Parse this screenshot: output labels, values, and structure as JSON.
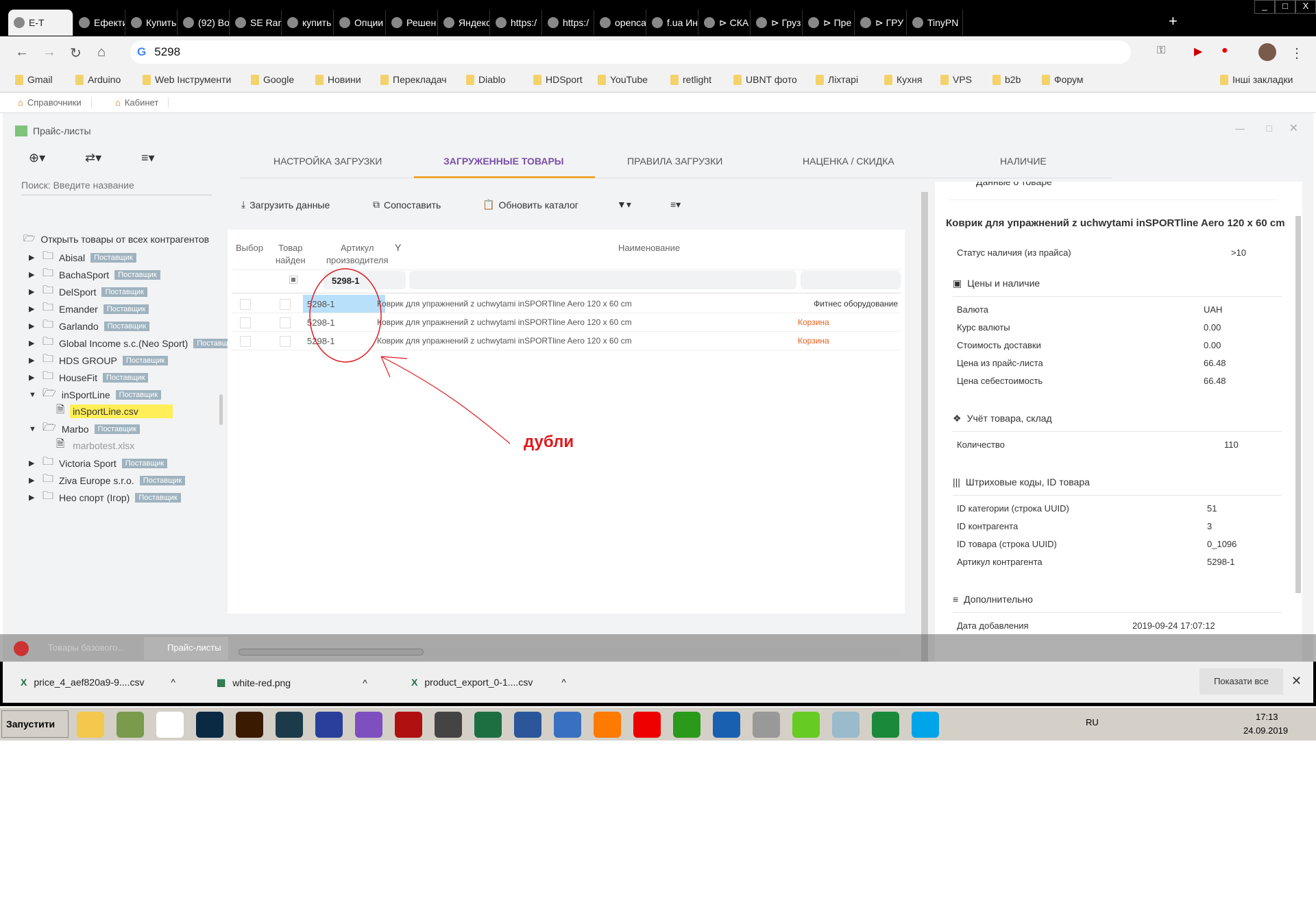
{
  "browser": {
    "tabs": [
      "E-T",
      "Ефекти",
      "Купить",
      "(92) Bo",
      "SE Ran",
      "купить",
      "Опции",
      "Решен",
      "Яндекс",
      "https:/",
      "https:/",
      "openca",
      "f.ua Ин",
      "⊳ СКА",
      "⊳ Груз",
      "⊳ Пре",
      "⊳ ГРУ",
      "TinyPN"
    ],
    "address": "5298",
    "bookmarks": [
      "Gmail",
      "Arduino",
      "Web Інструменти",
      "Google",
      "Новини",
      "Перекладач",
      "Diablo",
      "HDSport",
      "YouTube",
      "retlight",
      "UBNT фото",
      "Ліхтарі",
      "Кухня",
      "VPS",
      "b2b",
      "Форум"
    ],
    "other_bookmarks": "Інші закладки",
    "app_tabs": [
      "Справочники",
      "Кабинет"
    ]
  },
  "window": {
    "title": "Прайс-листы"
  },
  "left": {
    "search_placeholder": "Поиск: Введите название",
    "root": "Открыть товары от всех контрагентов",
    "badge": "Поставщик",
    "items": [
      {
        "name": "Abisal",
        "open": false
      },
      {
        "name": "BachaSport",
        "open": false
      },
      {
        "name": "DelSport",
        "open": false
      },
      {
        "name": "Emander",
        "open": false
      },
      {
        "name": "Garlando",
        "open": false
      },
      {
        "name": "Global Income s.c.(Neo Sport)",
        "open": false
      },
      {
        "name": "HDS GROUP",
        "open": false
      },
      {
        "name": "HouseFit",
        "open": false
      },
      {
        "name": "inSportLine",
        "open": true,
        "file": "inSportLine.csv"
      },
      {
        "name": "Marbo",
        "open": true,
        "file": "marbotest.xlsx"
      },
      {
        "name": "Victoria Sport",
        "open": false
      },
      {
        "name": "Ziva Europe s.r.o.",
        "open": false
      },
      {
        "name": "Нео спорт (Ігор)",
        "open": false
      }
    ]
  },
  "tabs": [
    "Настройка загрузки",
    "Загруженные товары",
    "Правила загрузки",
    "Наценка / скидка",
    "Наличие"
  ],
  "active_tab": 1,
  "toolbar": {
    "load": "Загрузить данные",
    "compare": "Сопоставить",
    "update": "Обновить каталог"
  },
  "table": {
    "headers": {
      "select": "Выбор",
      "found1": "Товар",
      "found2": "найден",
      "art1": "Артикул",
      "art2": "производителя",
      "name": "Наименование"
    },
    "filter_article": "5298-1",
    "rows": [
      {
        "article": "5298-1",
        "name": "Коврик для упражнений z uchwytami inSPORTline Aero 120 x 60 cm",
        "category": "Фитнес оборудование",
        "selected": true
      },
      {
        "article": "5298-1",
        "name": "Коврик для упражнений z uchwytami inSPORTline Aero 120 x 60 cm",
        "category": "Корзина",
        "selected": false
      },
      {
        "article": "5298-1",
        "name": "Коврик для упражнений z uchwytami inSPORTline Aero 120 x 60 cm",
        "category": "Корзина",
        "selected": false
      }
    ]
  },
  "annotation": {
    "text": "дубли",
    "color": "#e0191e"
  },
  "details": {
    "header": "Данные о товаре",
    "title": "Коврик для упражнений z uchwytami inSPORTline Aero 120 x 60 cm",
    "status_label": "Статус наличия (из прайса)",
    "status_value": ">10",
    "prices_title": "Цены и наличие",
    "prices": [
      [
        "Валюта",
        "UAH"
      ],
      [
        "Курс валюты",
        "0.00"
      ],
      [
        "Стоимость доставки",
        "0.00"
      ],
      [
        "Цена из прайс-листа",
        "66.48"
      ],
      [
        "Цена себестоимость",
        "66.48"
      ]
    ],
    "stock_title": "Учёт товара, склад",
    "stock": [
      [
        "Количество",
        "110"
      ]
    ],
    "ids_title": "Штриховые коды, ID товара",
    "ids": [
      [
        "ID категории (строка UUID)",
        "51"
      ],
      [
        "ID контрагента",
        "3"
      ],
      [
        "ID товара (строка UUID)",
        "0_1096"
      ],
      [
        "Артикул контрагента",
        "5298-1"
      ]
    ],
    "extra_title": "Дополнительно",
    "extra": [
      [
        "Дата добавления",
        "2019-09-24 17:07:12"
      ]
    ]
  },
  "app_taskbar": [
    "Товары базового...",
    "Прайс-листы"
  ],
  "downloads": {
    "files": [
      "price_4_aef820a9-9....csv",
      "white-red.png",
      "product_export_0-1....csv"
    ],
    "show_all": "Показати все"
  },
  "taskbar": {
    "start": "Запустити",
    "lang": "RU",
    "time": "17:13",
    "date": "24.09.2019"
  }
}
